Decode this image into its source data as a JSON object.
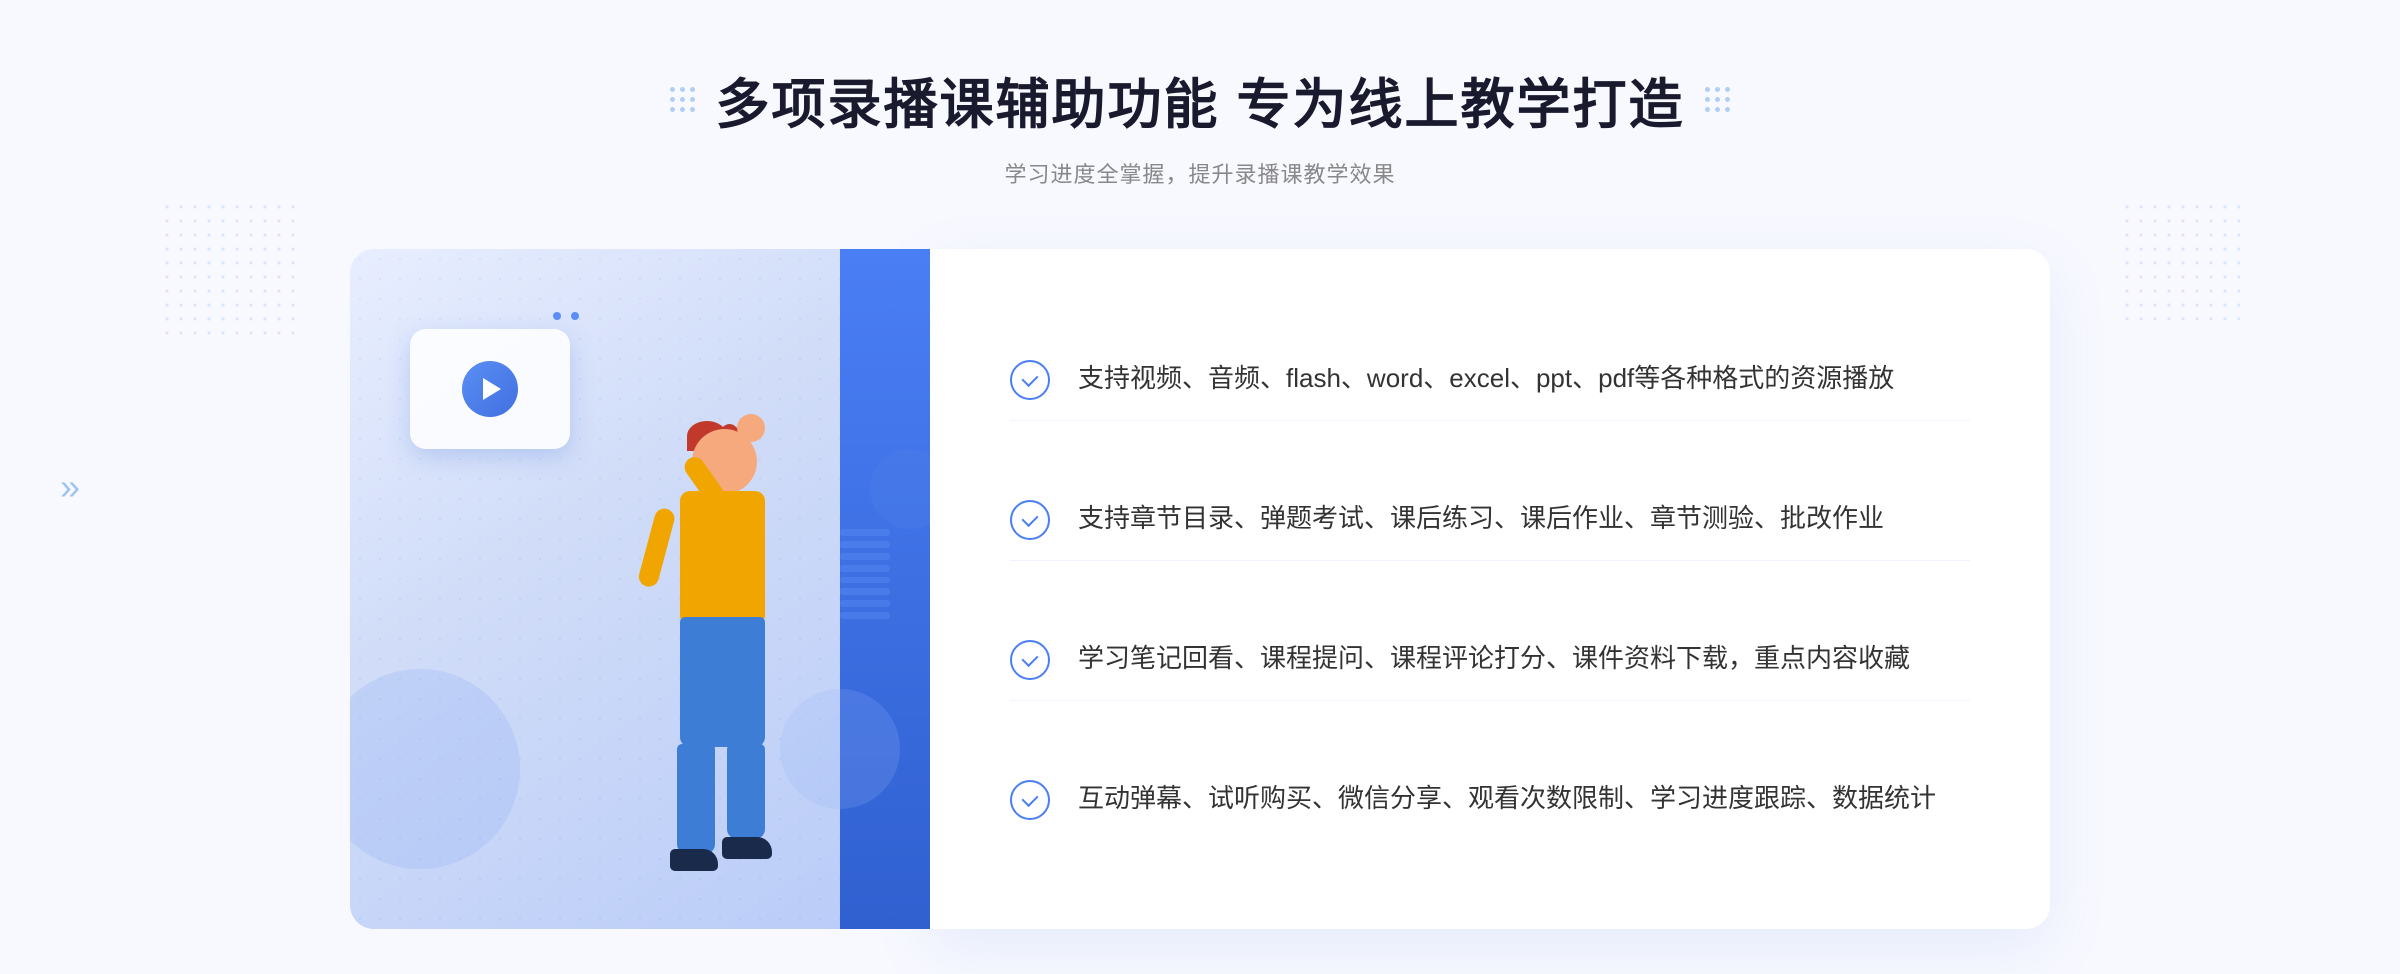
{
  "page": {
    "background_color": "#f8f9ff"
  },
  "header": {
    "title": "多项录播课辅助功能 专为线上教学打造",
    "subtitle": "学习进度全掌握，提升录播课教学效果"
  },
  "features": [
    {
      "id": 1,
      "text": "支持视频、音频、flash、word、excel、ppt、pdf等各种格式的资源播放"
    },
    {
      "id": 2,
      "text": "支持章节目录、弹题考试、课后练习、课后作业、章节测验、批改作业"
    },
    {
      "id": 3,
      "text": "学习笔记回看、课程提问、课程评论打分、课件资料下载，重点内容收藏"
    },
    {
      "id": 4,
      "text": "互动弹幕、试听购买、微信分享、观看次数限制、学习进度跟踪、数据统计"
    }
  ]
}
